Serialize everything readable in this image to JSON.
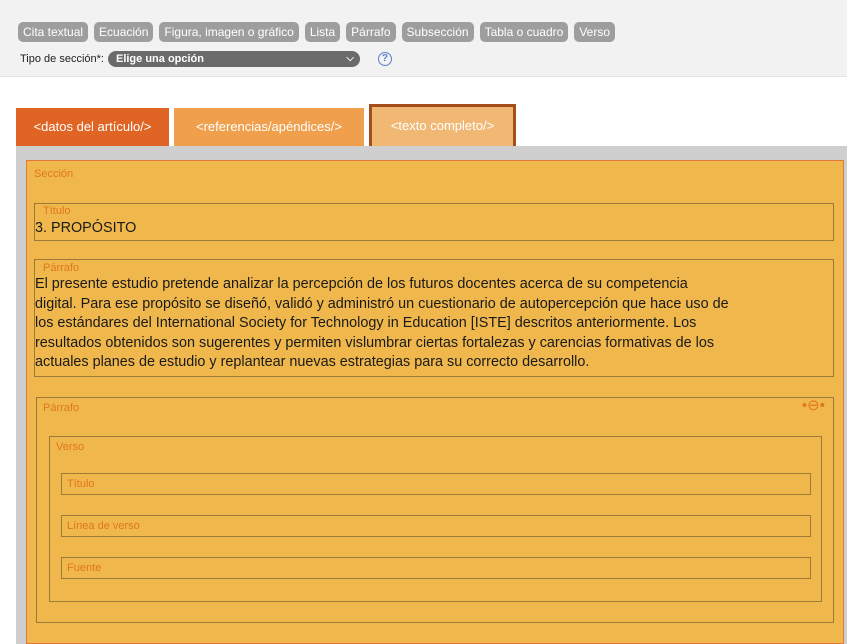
{
  "toolbar": {
    "buttons": [
      "Cita textual",
      "Ecuación",
      "Figura, imagen o gráfico",
      "Lista",
      "Párrafo",
      "Subsección",
      "Tabla o cuadro",
      "Verso"
    ],
    "section_type_label": "Tipo de sección*:",
    "section_type_value": "Elige una opción",
    "help_symbol": "?"
  },
  "tabs": [
    {
      "label": "<datos del artículo/>"
    },
    {
      "label": "<referencias/apéndices/>"
    },
    {
      "label": "<texto completo/>",
      "active": true
    }
  ],
  "section": {
    "label": "Sección",
    "title": {
      "label": "Título",
      "value": "3. PROPÓSITO"
    },
    "paragraph": {
      "label": "Párrafo",
      "lines": [
        "El presente estudio pretende analizar la percepción de los futuros docentes acerca de su competencia",
        "digital. Para ese propósito se diseñó, validó y administró un cuestionario de autopercepción que hace uso de",
        "los estándares del International Society for Technology in Education [ISTE] descritos anteriormente. Los",
        "resultados obtenidos son sugerentes y permiten vislumbrar ciertas fortalezas y carencias formativas de los",
        "actuales planes de estudio y replantear nuevas estrategias para su correcto desarrollo."
      ]
    },
    "paragraph2": {
      "label": "Párrafo",
      "verse": {
        "label": "Verso",
        "fields": {
          "title": "Título",
          "line": "Línea de verso",
          "source": "Fuente"
        }
      }
    }
  },
  "colors": {
    "tab_dark": "#e06524",
    "tab_mid": "#f0a04c",
    "tab_active": "#f0b873",
    "section_bg": "#f0b84c",
    "label": "#e0761e"
  }
}
